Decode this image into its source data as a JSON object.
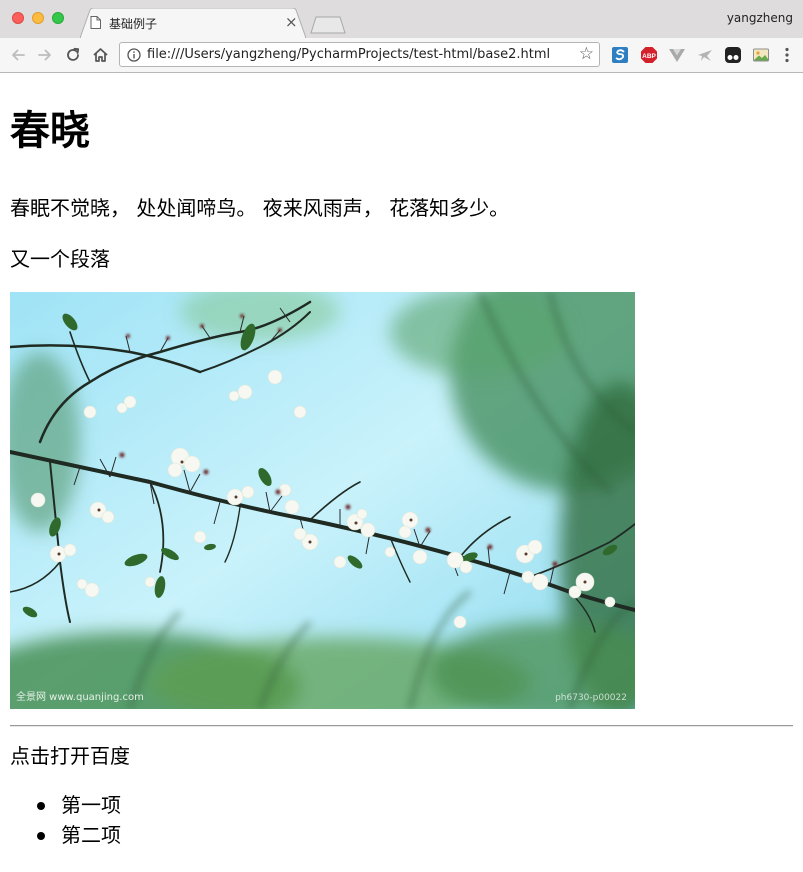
{
  "browser": {
    "tab_title": "基础例子",
    "tab_close": "×",
    "profile_name": "yangzheng",
    "address_url": "file:///Users/yangzheng/PycharmProjects/test-html/base2.html",
    "star": "☆",
    "photo_watermark_left": "全景网 www.quanjing.com",
    "photo_watermark_right": "ph6730-p00022"
  },
  "page": {
    "heading": "春晓",
    "poem": "春眠不觉晓， 处处闻啼鸟。 夜来风雨声， 花落知多少。",
    "paragraph": "又一个段落",
    "link_text": "点击打开百度",
    "list_items": [
      "第一项",
      "第二项"
    ]
  },
  "colors": {
    "sky_light": "#c9f2fb",
    "sky_mid": "#7fd9f0",
    "foliage": "#2f6a2c",
    "branch": "#1f2a22"
  }
}
